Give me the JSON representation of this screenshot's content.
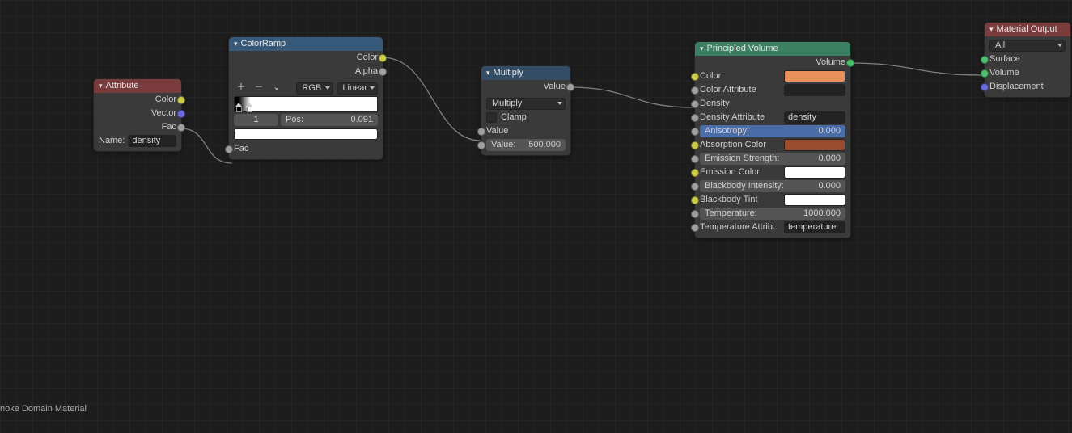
{
  "material_label": "noke Domain Material",
  "attribute": {
    "title": "Attribute",
    "out_color": "Color",
    "out_vector": "Vector",
    "out_fac": "Fac",
    "name_label": "Name:",
    "name_value": "density"
  },
  "colorramp": {
    "title": "ColorRamp",
    "out_color": "Color",
    "out_alpha": "Alpha",
    "mode": "RGB",
    "interp": "Linear",
    "stop_index": "1",
    "pos_label": "Pos:",
    "pos_value": "0.091",
    "swatch_hex": "#ffffff",
    "in_fac": "Fac"
  },
  "multiply": {
    "title": "Multiply",
    "out_value": "Value",
    "op": "Multiply",
    "clamp_label": "Clamp",
    "in1_label": "Value",
    "in2_label": "Value:",
    "in2_value": "500.000"
  },
  "pv": {
    "title": "Principled Volume",
    "out_volume": "Volume",
    "items": [
      {
        "label": "Color",
        "type": "swatch",
        "hex": "#e8915c"
      },
      {
        "label": "Color Attribute",
        "type": "text",
        "value": ""
      },
      {
        "label": "Density",
        "type": "linked"
      },
      {
        "label": "Density Attribute",
        "type": "text",
        "value": "density"
      },
      {
        "label": "Anisotropy:",
        "type": "num",
        "value": "0.000",
        "accent": true
      },
      {
        "label": "Absorption Color",
        "type": "swatch",
        "hex": "#9a4d2e"
      },
      {
        "label": "Emission Strength:",
        "type": "num",
        "value": "0.000"
      },
      {
        "label": "Emission Color",
        "type": "swatch",
        "hex": "#ffffff"
      },
      {
        "label": "Blackbody Intensity:",
        "type": "num",
        "value": "0.000"
      },
      {
        "label": "Blackbody Tint",
        "type": "swatch",
        "hex": "#ffffff"
      },
      {
        "label": "Temperature:",
        "type": "num",
        "value": "1000.000"
      },
      {
        "label": "Temperature Attrib..",
        "type": "text",
        "value": "temperature"
      }
    ]
  },
  "output": {
    "title": "Material Output",
    "target": "All",
    "in_surface": "Surface",
    "in_volume": "Volume",
    "in_disp": "Displacement"
  }
}
